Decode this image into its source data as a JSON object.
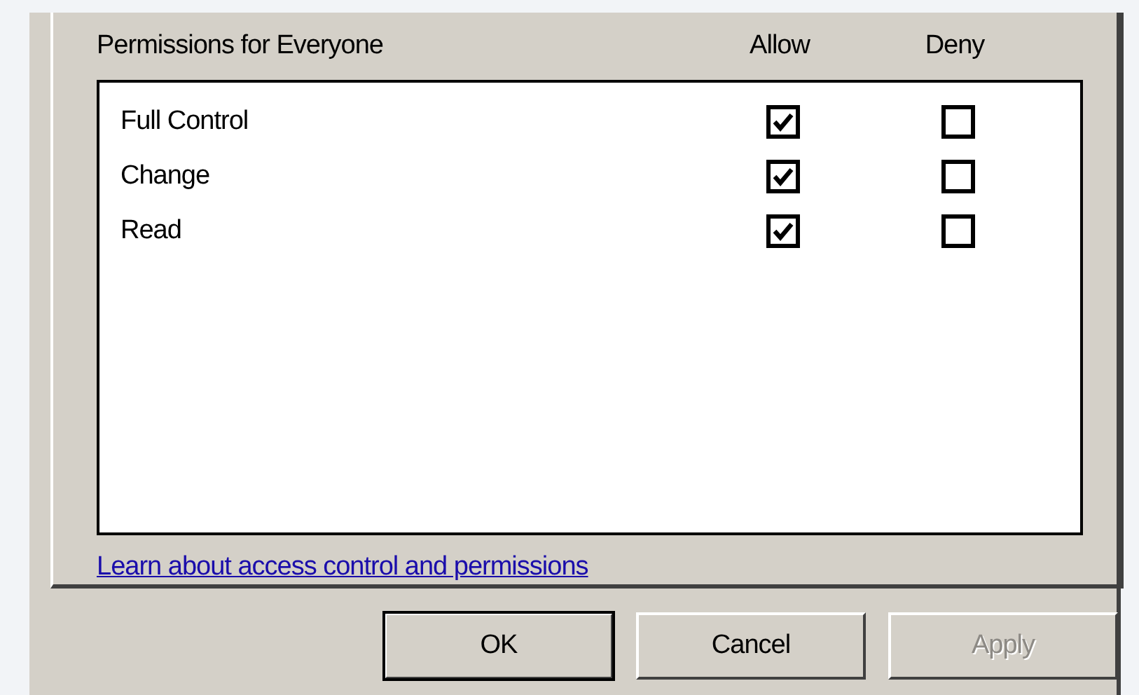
{
  "permissions_header": {
    "title": "Permissions for Everyone",
    "columns": [
      "Allow",
      "Deny"
    ]
  },
  "permissions": [
    {
      "name": "Full Control",
      "allow": true,
      "deny": false
    },
    {
      "name": "Change",
      "allow": true,
      "deny": false
    },
    {
      "name": "Read",
      "allow": true,
      "deny": false
    }
  ],
  "help_link": "Learn about access control and permissions",
  "buttons": [
    {
      "label": "OK",
      "default": true,
      "disabled": false
    },
    {
      "label": "Cancel",
      "default": false,
      "disabled": false
    },
    {
      "label": "Apply",
      "default": false,
      "disabled": true
    }
  ]
}
